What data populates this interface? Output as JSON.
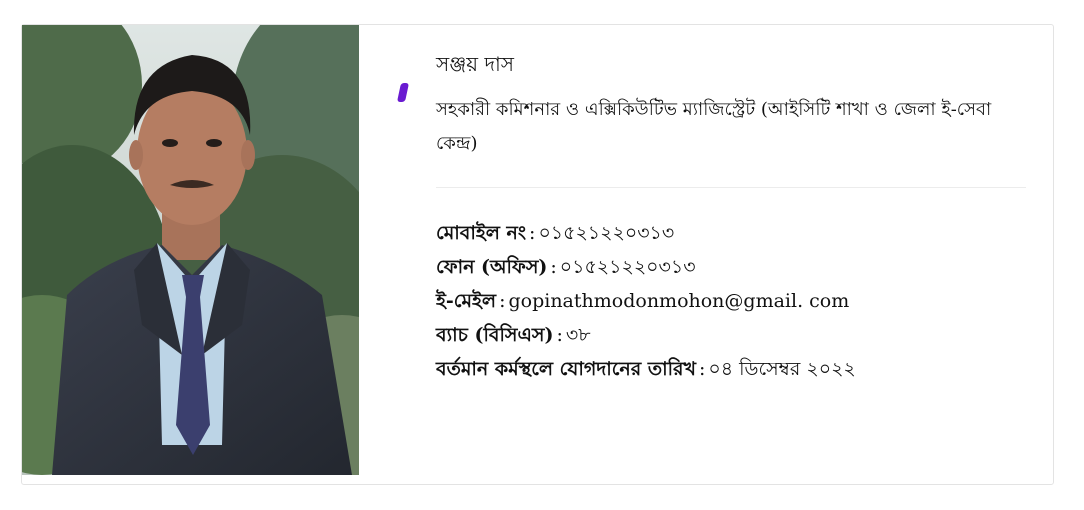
{
  "profile": {
    "name": "সঞ্জয় দাস",
    "designation": "সহকারী কমিশনার ও এক্সিকিউটিভ ম্যাজিস্ট্রেট (আইসিটি শাখা ও জেলা ই-সেবা কেন্দ্র)",
    "photo_icon": "officer-portrait-photo",
    "accent_color": "#6a1bd1"
  },
  "details": [
    {
      "label": "মোবাইল নং",
      "value": "০১৫২১২২০৩১৩"
    },
    {
      "label": "ফোন (অফিস)",
      "value": "০১৫২১২২০৩১৩"
    },
    {
      "label": "ই-মেইল",
      "value": "gopinathmodonmohon@gmail. com"
    },
    {
      "label": "ব্যাচ (বিসিএস)",
      "value": "৩৮"
    },
    {
      "label": "বর্তমান কর্মস্থলে যোগদানের তারিখ",
      "value": "০৪ ডিসেম্বর ২০২২"
    }
  ],
  "separator": ":"
}
